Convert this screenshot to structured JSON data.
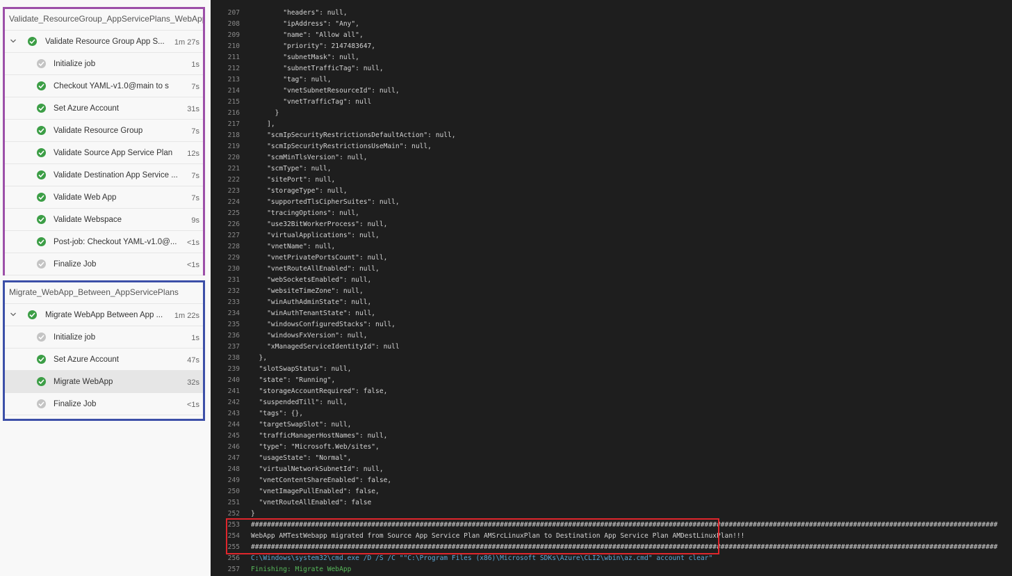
{
  "stages": [
    {
      "title": "Validate_ResourceGroup_AppServicePlans_WebApp",
      "job": {
        "label": "Validate Resource Group App S...",
        "duration": "1m 27s"
      },
      "steps": [
        {
          "label": "Initialize job",
          "duration": "1s",
          "status": "skip"
        },
        {
          "label": "Checkout YAML-v1.0@main to s",
          "duration": "7s",
          "status": "ok"
        },
        {
          "label": "Set Azure Account",
          "duration": "31s",
          "status": "ok"
        },
        {
          "label": "Validate Resource Group",
          "duration": "7s",
          "status": "ok"
        },
        {
          "label": "Validate Source App Service Plan",
          "duration": "12s",
          "status": "ok"
        },
        {
          "label": "Validate Destination App Service ...",
          "duration": "7s",
          "status": "ok"
        },
        {
          "label": "Validate Web App",
          "duration": "7s",
          "status": "ok"
        },
        {
          "label": "Validate Webspace",
          "duration": "9s",
          "status": "ok"
        },
        {
          "label": "Post-job: Checkout YAML-v1.0@...",
          "duration": "<1s",
          "status": "ok"
        },
        {
          "label": "Finalize Job",
          "duration": "<1s",
          "status": "skip"
        }
      ]
    },
    {
      "title": "Migrate_WebApp_Between_AppServicePlans",
      "job": {
        "label": "Migrate WebApp Between App ...",
        "duration": "1m 22s"
      },
      "steps": [
        {
          "label": "Initialize job",
          "duration": "1s",
          "status": "skip"
        },
        {
          "label": "Set Azure Account",
          "duration": "47s",
          "status": "ok"
        },
        {
          "label": "Migrate WebApp",
          "duration": "32s",
          "status": "ok",
          "selected": true
        },
        {
          "label": "Finalize Job",
          "duration": "<1s",
          "status": "skip"
        }
      ]
    }
  ],
  "colors": {
    "success": "#3c9e46",
    "skipped": "#c4c4c4",
    "stage1_border": "#9c4fa8",
    "stage2_border": "#3c4fa8",
    "highlight": "#e0262c",
    "log_bg": "#1e1e1e"
  },
  "log": {
    "lines": [
      {
        "n": "207",
        "t": "        \"headers\": null,"
      },
      {
        "n": "208",
        "t": "        \"ipAddress\": \"Any\","
      },
      {
        "n": "209",
        "t": "        \"name\": \"Allow all\","
      },
      {
        "n": "210",
        "t": "        \"priority\": 2147483647,"
      },
      {
        "n": "211",
        "t": "        \"subnetMask\": null,"
      },
      {
        "n": "212",
        "t": "        \"subnetTrafficTag\": null,"
      },
      {
        "n": "213",
        "t": "        \"tag\": null,"
      },
      {
        "n": "214",
        "t": "        \"vnetSubnetResourceId\": null,"
      },
      {
        "n": "215",
        "t": "        \"vnetTrafficTag\": null"
      },
      {
        "n": "216",
        "t": "      }"
      },
      {
        "n": "217",
        "t": "    ],"
      },
      {
        "n": "218",
        "t": "    \"scmIpSecurityRestrictionsDefaultAction\": null,"
      },
      {
        "n": "219",
        "t": "    \"scmIpSecurityRestrictionsUseMain\": null,"
      },
      {
        "n": "220",
        "t": "    \"scmMinTlsVersion\": null,"
      },
      {
        "n": "221",
        "t": "    \"scmType\": null,"
      },
      {
        "n": "222",
        "t": "    \"sitePort\": null,"
      },
      {
        "n": "223",
        "t": "    \"storageType\": null,"
      },
      {
        "n": "224",
        "t": "    \"supportedTlsCipherSuites\": null,"
      },
      {
        "n": "225",
        "t": "    \"tracingOptions\": null,"
      },
      {
        "n": "226",
        "t": "    \"use32BitWorkerProcess\": null,"
      },
      {
        "n": "227",
        "t": "    \"virtualApplications\": null,"
      },
      {
        "n": "228",
        "t": "    \"vnetName\": null,"
      },
      {
        "n": "229",
        "t": "    \"vnetPrivatePortsCount\": null,"
      },
      {
        "n": "230",
        "t": "    \"vnetRouteAllEnabled\": null,"
      },
      {
        "n": "231",
        "t": "    \"webSocketsEnabled\": null,"
      },
      {
        "n": "232",
        "t": "    \"websiteTimeZone\": null,"
      },
      {
        "n": "233",
        "t": "    \"winAuthAdminState\": null,"
      },
      {
        "n": "234",
        "t": "    \"winAuthTenantState\": null,"
      },
      {
        "n": "235",
        "t": "    \"windowsConfiguredStacks\": null,"
      },
      {
        "n": "236",
        "t": "    \"windowsFxVersion\": null,"
      },
      {
        "n": "237",
        "t": "    \"xManagedServiceIdentityId\": null"
      },
      {
        "n": "238",
        "t": "  },"
      },
      {
        "n": "239",
        "t": "  \"slotSwapStatus\": null,"
      },
      {
        "n": "240",
        "t": "  \"state\": \"Running\","
      },
      {
        "n": "241",
        "t": "  \"storageAccountRequired\": false,"
      },
      {
        "n": "242",
        "t": "  \"suspendedTill\": null,"
      },
      {
        "n": "243",
        "t": "  \"tags\": {},"
      },
      {
        "n": "244",
        "t": "  \"targetSwapSlot\": null,"
      },
      {
        "n": "245",
        "t": "  \"trafficManagerHostNames\": null,"
      },
      {
        "n": "246",
        "t": "  \"type\": \"Microsoft.Web/sites\","
      },
      {
        "n": "247",
        "t": "  \"usageState\": \"Normal\","
      },
      {
        "n": "248",
        "t": "  \"virtualNetworkSubnetId\": null,"
      },
      {
        "n": "249",
        "t": "  \"vnetContentShareEnabled\": false,"
      },
      {
        "n": "250",
        "t": "  \"vnetImagePullEnabled\": false,"
      },
      {
        "n": "251",
        "t": "  \"vnetRouteAllEnabled\": false"
      },
      {
        "n": "252",
        "t": "}"
      },
      {
        "n": "253",
        "t": "##########################################################################################################################################################################################"
      },
      {
        "n": "254",
        "t": "WebApp AMTestWebapp migrated from Source App Service Plan AMSrcLinuxPlan to Destination App Service Plan AMDestLinuxPlan!!!"
      },
      {
        "n": "255",
        "t": "##########################################################################################################################################################################################"
      },
      {
        "n": "256",
        "t": "C:\\Windows\\system32\\cmd.exe /D /S /C \"\"C:\\Program Files (x86)\\Microsoft SDKs\\Azure\\CLI2\\wbin\\az.cmd\" account clear\"",
        "kind": "cmd"
      },
      {
        "n": "257",
        "t": "Finishing: Migrate WebApp",
        "kind": "fin"
      }
    ]
  }
}
